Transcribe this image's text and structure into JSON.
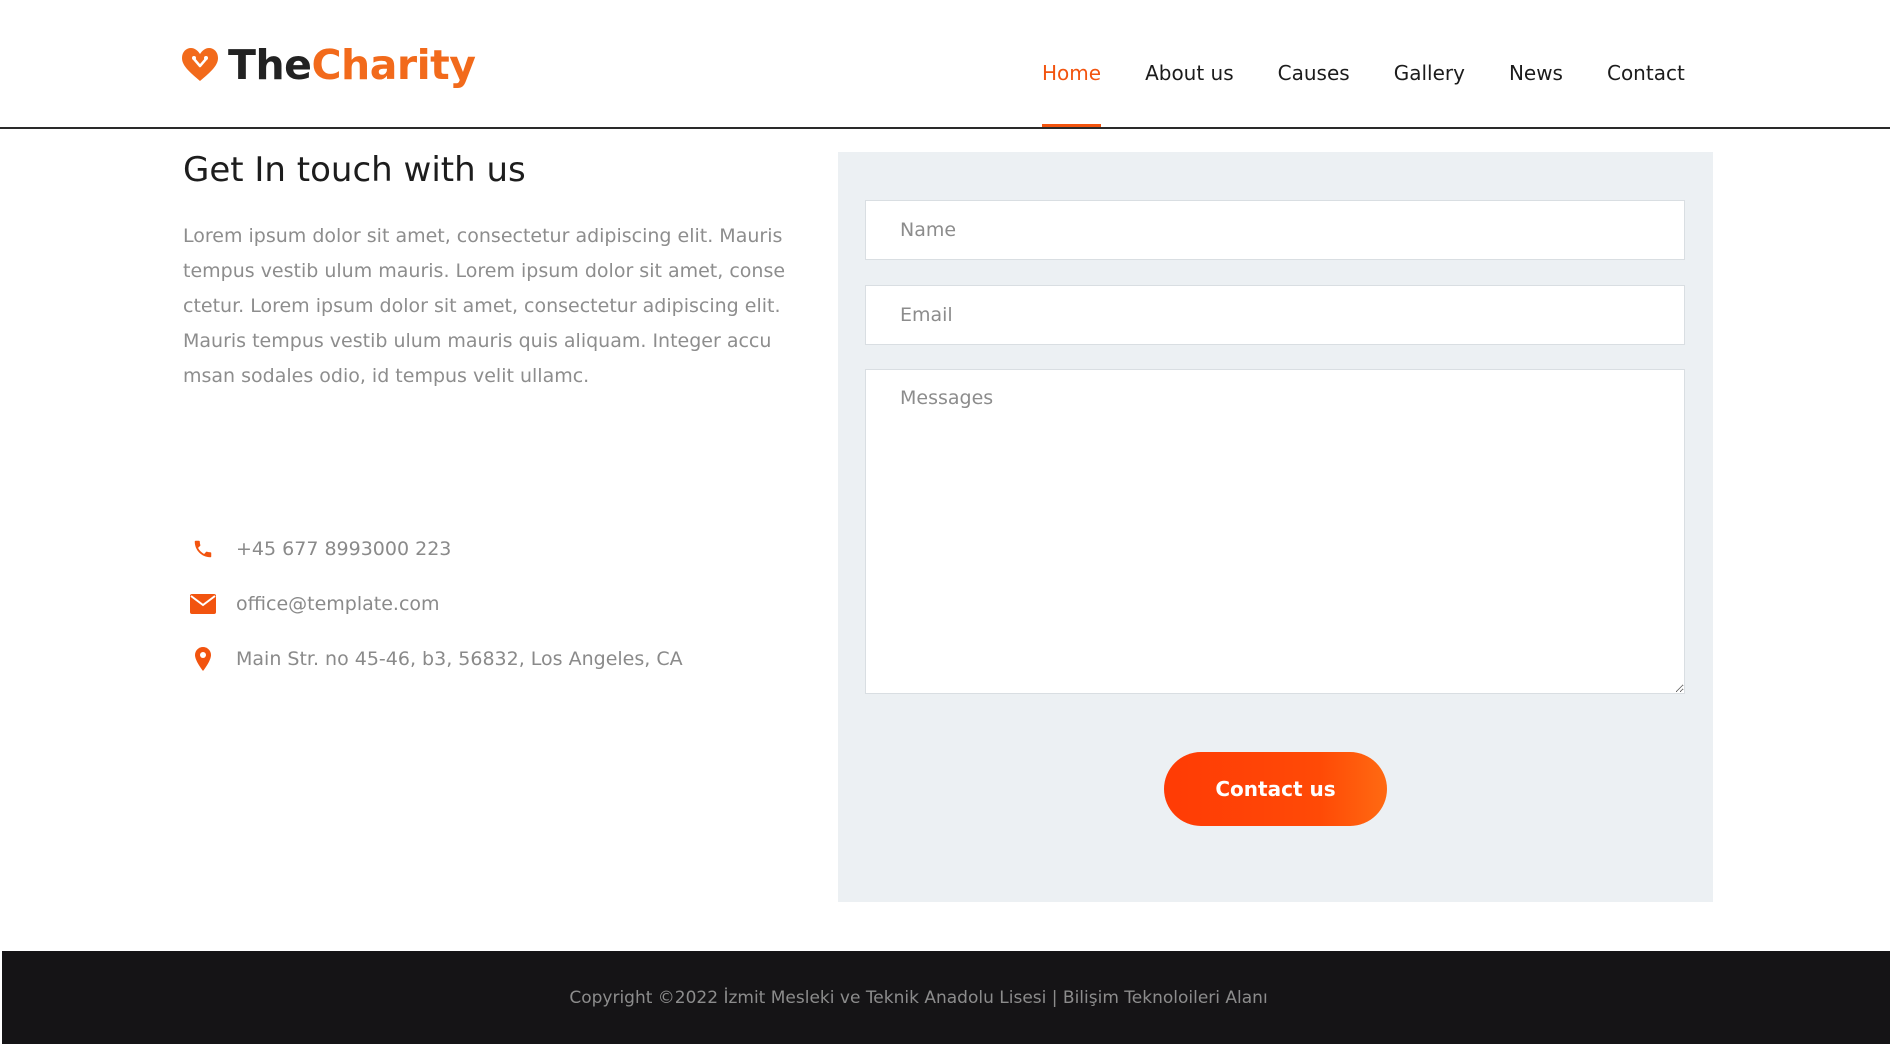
{
  "brand": {
    "name_part1": "The",
    "name_part2": "Charity"
  },
  "nav": {
    "items": [
      {
        "label": "Home",
        "active": true
      },
      {
        "label": "About us",
        "active": false
      },
      {
        "label": "Causes",
        "active": false
      },
      {
        "label": "Gallery",
        "active": false
      },
      {
        "label": "News",
        "active": false
      },
      {
        "label": "Contact",
        "active": false
      }
    ]
  },
  "contact": {
    "title": "Get In touch with us",
    "intro": "Lorem ipsum dolor sit amet, consectetur adipiscing elit. Mauris tempus vestib ulum mauris. Lorem ipsum dolor sit amet, conse ctetur. Lorem ipsum dolor sit amet, consectetur adipiscing elit. Mauris tempus vestib ulum mauris quis aliquam. Integer accu msan sodales odio, id tempus velit ullamc.",
    "phone": "+45 677 8993000 223",
    "email": "office@template.com",
    "address": "Main Str. no 45-46, b3, 56832, Los Angeles, CA",
    "icons": [
      "phone-icon",
      "envelope-icon",
      "map-pin-icon"
    ]
  },
  "form": {
    "name_placeholder": "Name",
    "email_placeholder": "Email",
    "message_placeholder": "Messages",
    "name_value": "",
    "email_value": "",
    "message_value": "",
    "submit_label": "Contact us"
  },
  "footer": {
    "copyright": "Copyright ©2022 İzmit Mesleki ve Teknik Anadolu Lisesi | Bilişim Teknoloileri Alanı"
  },
  "colors": {
    "accent": "#f2540f",
    "button": "#ff4306",
    "panel": "#ecf0f3",
    "footer": "#151416"
  }
}
